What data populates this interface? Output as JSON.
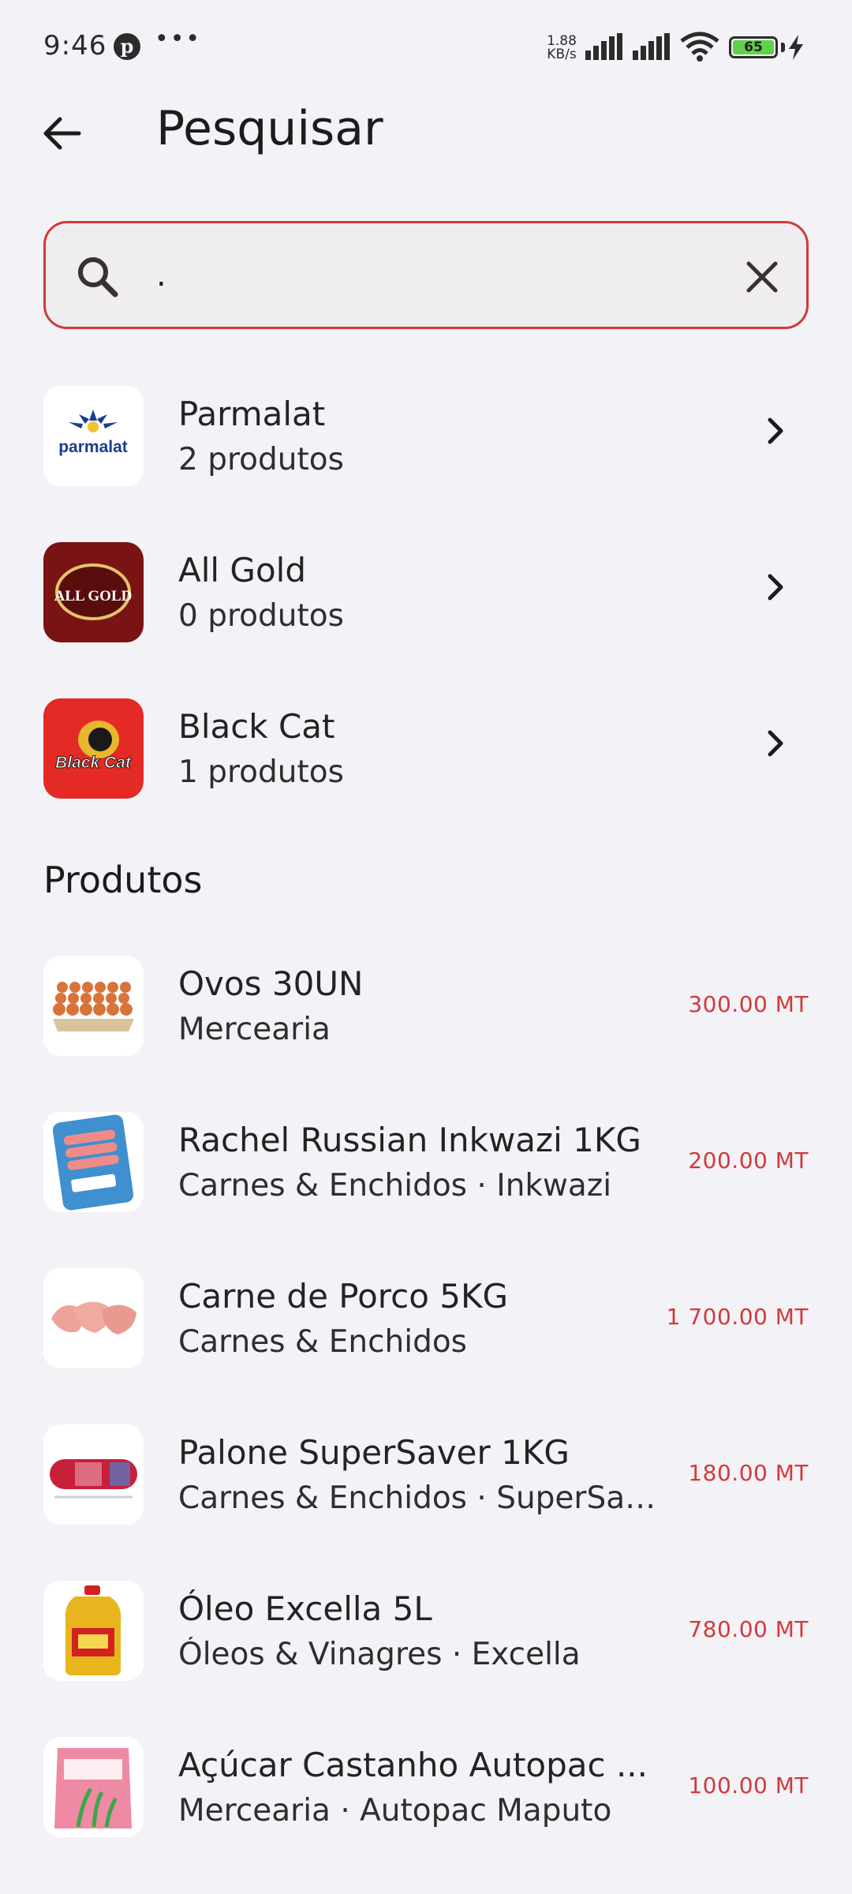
{
  "status_bar": {
    "time": "9:46",
    "net_speed_value": "1.88",
    "net_speed_unit": "KB/s",
    "battery": "65",
    "icons": [
      "pinterest-icon",
      "more-dots-icon",
      "signal-icon",
      "wifi-icon",
      "battery-icon",
      "charging-icon"
    ]
  },
  "header": {
    "title": "Pesquisar",
    "back_icon": "arrow-left-icon"
  },
  "search": {
    "value": ".",
    "icon": "search-icon",
    "clear_icon": "close-icon"
  },
  "brands": [
    {
      "name": "Parmalat",
      "count": "2 produtos",
      "logo_text": "parmalat"
    },
    {
      "name": "All Gold",
      "count": "0 produtos",
      "logo_text": "ALL GOLD"
    },
    {
      "name": "Black Cat",
      "count": "1 produtos",
      "logo_text": "Black Cat"
    }
  ],
  "products_section": {
    "title": "Produtos"
  },
  "products": [
    {
      "name": "Ovos 30UN",
      "category": "Mercearia",
      "price": "300.00 MT"
    },
    {
      "name": "Rachel Russian Inkwazi 1KG",
      "category": "Carnes & Enchidos · Inkwazi",
      "price": "200.00 MT"
    },
    {
      "name": "Carne de Porco 5KG",
      "category": "Carnes & Enchidos",
      "price": "1 700.00 MT"
    },
    {
      "name": "Palone SuperSaver 1KG",
      "category": "Carnes & Enchidos · SuperSaver",
      "price": "180.00 MT"
    },
    {
      "name": "Óleo Excella 5L",
      "category": "Óleos & Vinagres · Excella",
      "price": "780.00 MT"
    },
    {
      "name": "Açúcar Castanho Autopac ...",
      "category": "Mercearia · Autopac Maputo",
      "price": "100.00 MT"
    }
  ],
  "colors": {
    "accent": "#d23a3a",
    "background": "#f3f2f7",
    "text": "#1f1f1f"
  }
}
